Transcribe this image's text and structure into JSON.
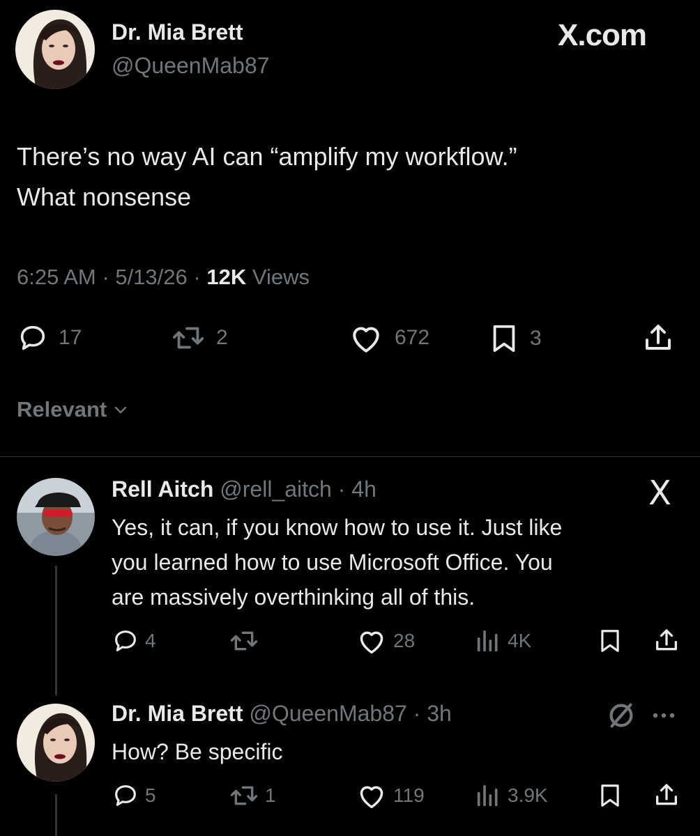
{
  "main_tweet": {
    "author_name": "Dr. Mia Brett",
    "author_handle": "@QueenMab87",
    "site_logo": "X.com",
    "text_line1": "There’s no way AI can “amplify my workflow.”",
    "text_line2": "What nonsense",
    "time": "6:25 AM",
    "date": "5/13/26",
    "views_count": "12K",
    "views_label": "Views",
    "separator": "·",
    "actions": {
      "replies": "17",
      "reposts": "2",
      "likes": "672",
      "bookmarks": "3"
    }
  },
  "sort": {
    "label": "Relevant"
  },
  "replies": [
    {
      "author_name": "Rell Aitch",
      "author_handle": "@rell_aitch",
      "time": "· 4h",
      "badge": "X",
      "text": [
        "Yes, it can, if you know how to use it. Just like",
        "you learned how to use Microsoft Office. You",
        "are massively overthinking all of this."
      ],
      "actions": {
        "replies": "4",
        "reposts": "",
        "likes": "28",
        "views": "4K"
      }
    },
    {
      "author_name": "Dr. Mia Brett",
      "author_handle": "@QueenMab87",
      "time": "· 3h",
      "text": [
        "How? Be specific"
      ],
      "actions": {
        "replies": "5",
        "reposts": "1",
        "likes": "119",
        "views": "3.9K"
      }
    }
  ],
  "colors": {
    "background": "#000000",
    "text_primary": "#e7e9ea",
    "text_secondary": "#71767b",
    "divider": "#2f3336"
  },
  "icons": [
    "reply-icon",
    "repost-icon",
    "like-icon",
    "bookmark-icon",
    "share-icon",
    "views-icon",
    "chevron-down-icon",
    "x-logo-icon",
    "no-symbol-icon",
    "more-icon"
  ]
}
